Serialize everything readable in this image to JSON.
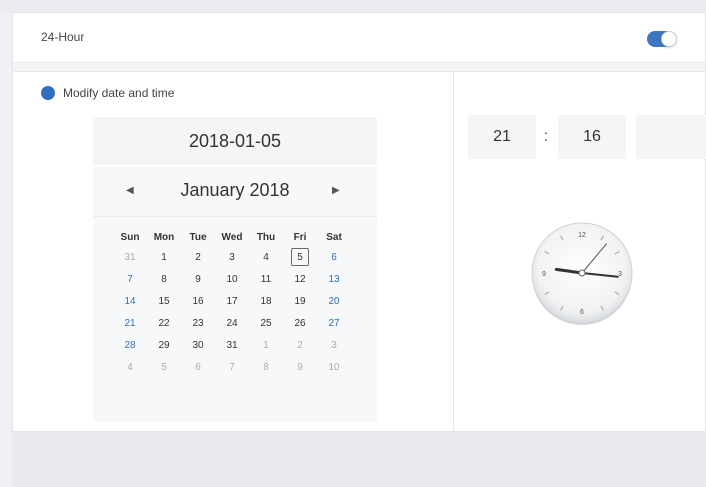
{
  "settings": {
    "hour24_label": "24-Hour",
    "hour24_enabled": true,
    "modify_label": "Modify date and time",
    "accent_color": "#2e6fbf"
  },
  "date": {
    "display": "2018-01-05"
  },
  "calendar": {
    "prev_icon": "◀",
    "next_icon": "▶",
    "month_title": "January 2018",
    "weekdays": [
      "Sun",
      "Mon",
      "Tue",
      "Wed",
      "Thu",
      "Fri",
      "Sat"
    ],
    "weeks": [
      [
        "31",
        "1",
        "2",
        "3",
        "4",
        "5",
        "6"
      ],
      [
        "7",
        "8",
        "9",
        "10",
        "11",
        "12",
        "13"
      ],
      [
        "14",
        "15",
        "16",
        "17",
        "18",
        "19",
        "20"
      ],
      [
        "21",
        "22",
        "23",
        "24",
        "25",
        "26",
        "27"
      ],
      [
        "28",
        "29",
        "30",
        "31",
        "1",
        "2",
        "3"
      ],
      [
        "4",
        "5",
        "6",
        "7",
        "8",
        "9",
        "10"
      ]
    ],
    "selected_day": "5"
  },
  "time": {
    "hour": "21",
    "separator": ":",
    "minute": "16",
    "second": ""
  },
  "clock": {
    "numerals": [
      "12",
      "3",
      "6",
      "9"
    ],
    "hour": 21,
    "minute": 16
  }
}
